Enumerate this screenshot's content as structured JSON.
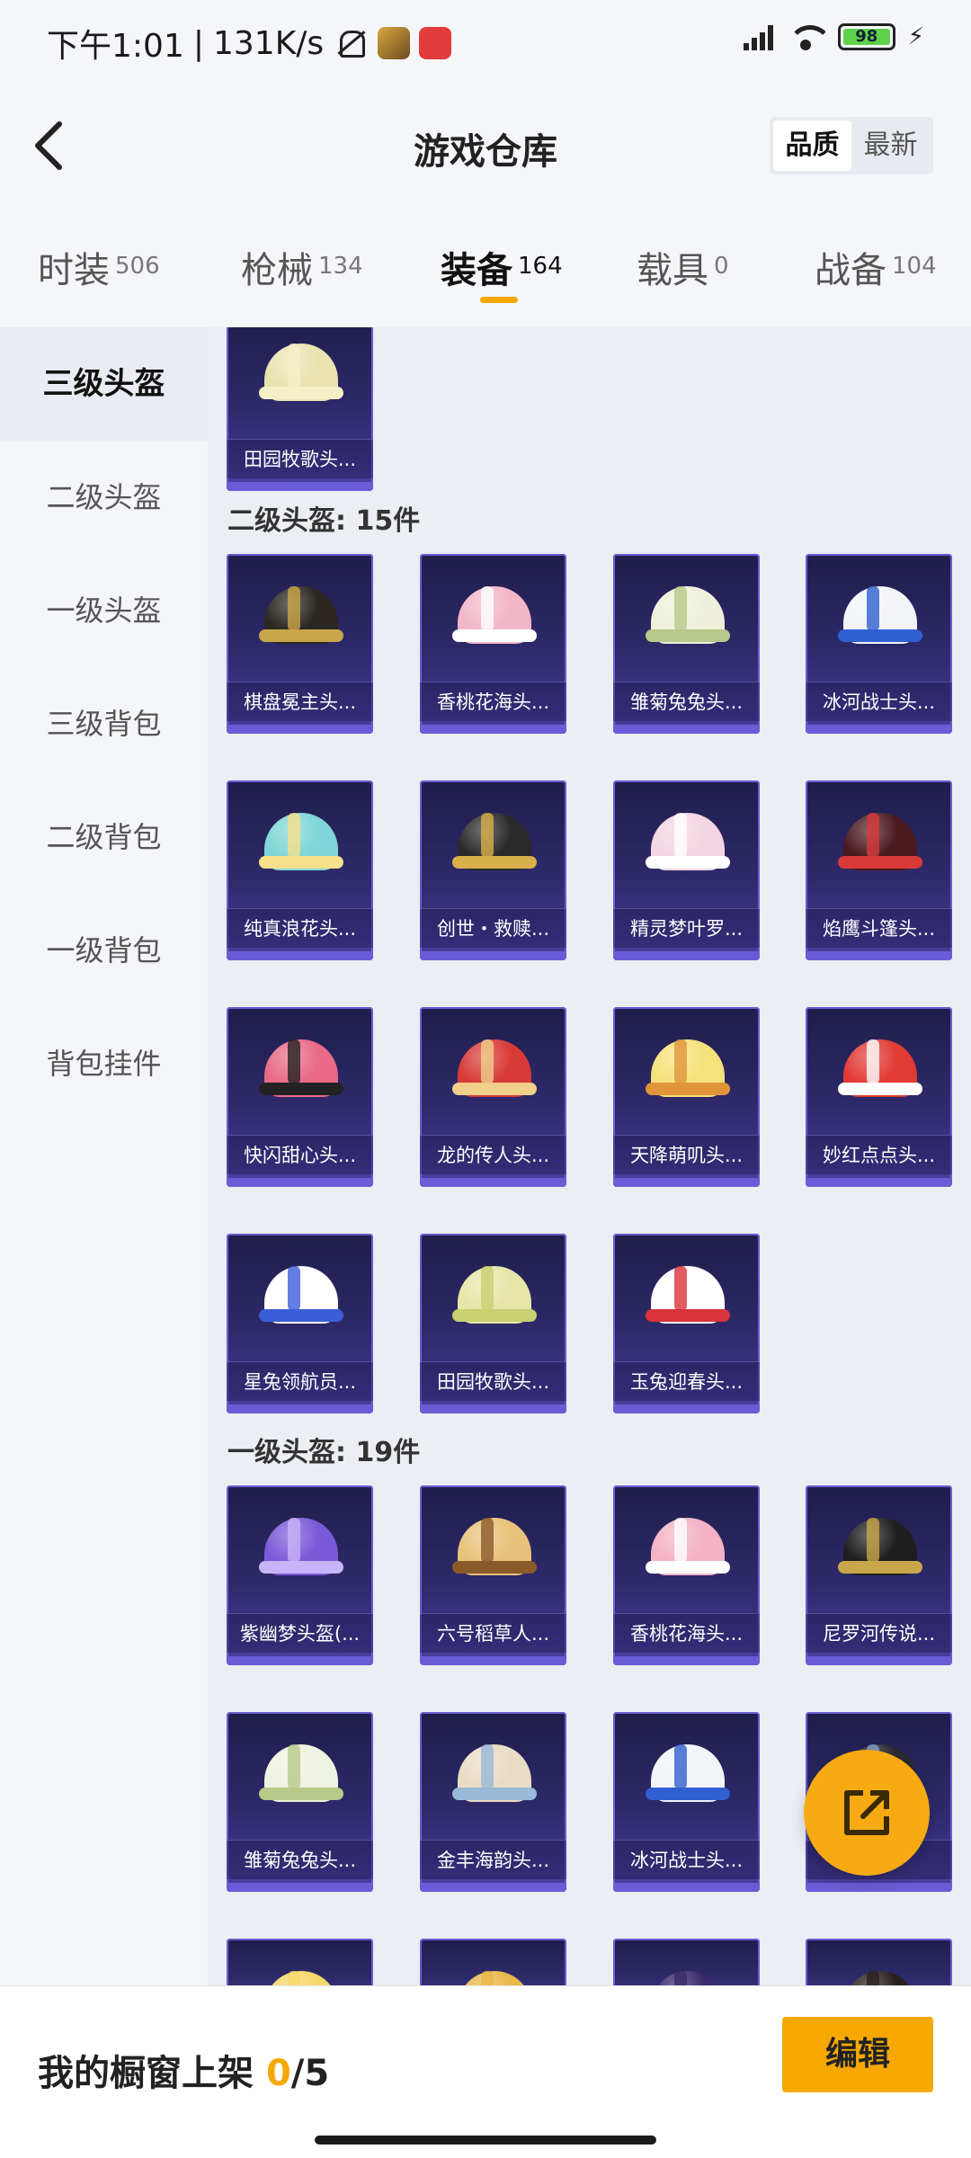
{
  "status": {
    "time": "下午1:01",
    "speed": "131K/s",
    "battery": "98"
  },
  "header": {
    "title": "游戏仓库",
    "sort_quality": "品质",
    "sort_newest": "最新"
  },
  "tabs": [
    {
      "label": "时装",
      "count": "506"
    },
    {
      "label": "枪械",
      "count": "134"
    },
    {
      "label": "装备",
      "count": "164"
    },
    {
      "label": "载具",
      "count": "0"
    },
    {
      "label": "战备",
      "count": "104"
    }
  ],
  "sidebar": [
    {
      "label": "三级头盔"
    },
    {
      "label": "二级头盔"
    },
    {
      "label": "一级头盔"
    },
    {
      "label": "三级背包"
    },
    {
      "label": "二级背包"
    },
    {
      "label": "一级背包"
    },
    {
      "label": "背包挂件"
    }
  ],
  "sections": {
    "level2": "二级头盔: 15件",
    "level1": "一级头盔: 19件"
  },
  "items_top": [
    {
      "name": "田园牧歌头...",
      "color": "#e8e3b0",
      "accent": "#f5f0c8"
    }
  ],
  "items_level2": [
    {
      "name": "棋盘冕主头...",
      "color": "#2b2620",
      "accent": "#c9a64a"
    },
    {
      "name": "香桃花海头...",
      "color": "#f2b6c8",
      "accent": "#ffffff"
    },
    {
      "name": "雏菊兔兔头...",
      "color": "#eef0dc",
      "accent": "#b8c98a"
    },
    {
      "name": "冰河战士头...",
      "color": "#f2f4f8",
      "accent": "#2f5fd0"
    },
    {
      "name": "纯真浪花头...",
      "color": "#7fd6d8",
      "accent": "#f7e08a"
    },
    {
      "name": "创世・救赎...",
      "color": "#2a2a2a",
      "accent": "#d8b04a"
    },
    {
      "name": "精灵梦叶罗...",
      "color": "#f4d6e2",
      "accent": "#ffffff"
    },
    {
      "name": "焰鹰斗篷头...",
      "color": "#4a1a20",
      "accent": "#d83a3a"
    },
    {
      "name": "快闪甜心头...",
      "color": "#e86a86",
      "accent": "#222222"
    },
    {
      "name": "龙的传人头...",
      "color": "#d83a36",
      "accent": "#f0d08a"
    },
    {
      "name": "天降萌叽头...",
      "color": "#f6e27a",
      "accent": "#e0953a"
    },
    {
      "name": "妙红点点头...",
      "color": "#e23a34",
      "accent": "#ffffff"
    },
    {
      "name": "星兔领航员...",
      "color": "#ffffff",
      "accent": "#3a5ed8"
    },
    {
      "name": "田园牧歌头...",
      "color": "#e6e6a8",
      "accent": "#c8d070"
    },
    {
      "name": "玉兔迎春头...",
      "color": "#ffffff",
      "accent": "#d8333a"
    }
  ],
  "items_level1": [
    {
      "name": "紫幽梦头盔(...",
      "color": "#7a5ad8",
      "accent": "#c8b4f8"
    },
    {
      "name": "六号稻草人...",
      "color": "#e8c27a",
      "accent": "#8a5a2a"
    },
    {
      "name": "香桃花海头...",
      "color": "#f4b2c4",
      "accent": "#ffffff"
    },
    {
      "name": "尼罗河传说...",
      "color": "#1e1e1e",
      "accent": "#c9a64a"
    },
    {
      "name": "雏菊兔兔头...",
      "color": "#eef2e0",
      "accent": "#b8c98a"
    },
    {
      "name": "金丰海韵头...",
      "color": "#e8dcc4",
      "accent": "#9ab8d8"
    },
    {
      "name": "冰河战士头...",
      "color": "#f2f4f8",
      "accent": "#2f5fd0"
    },
    {
      "name": "...)",
      "color": "#2a2a30",
      "accent": "#8aa0c8"
    }
  ],
  "items_partial": [
    {
      "color": "#f6d86a"
    },
    {
      "color": "#e8b84a"
    },
    {
      "color": "#3a2a6a"
    },
    {
      "color": "#2a2020"
    }
  ],
  "bottom": {
    "shelf_label": "我的橱窗上架",
    "shelf_count": "0",
    "shelf_total": "/5",
    "edit_label": "编辑"
  }
}
